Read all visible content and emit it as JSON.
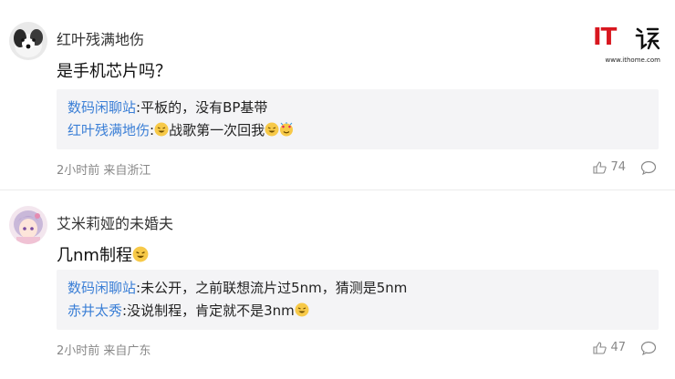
{
  "logo": {
    "text": "IT",
    "url": "www.ithome.com",
    "brand_color": "#d8171f"
  },
  "comments": [
    {
      "username": "红叶残满地伤",
      "content": "是手机芯片吗？",
      "replies": [
        {
          "user": "数码闲聊站",
          "sep": ":",
          "text": "平板的，没有BP基带"
        },
        {
          "user": "红叶残满地伤",
          "sep": ":",
          "text": "战歌第一次回我"
        }
      ],
      "time": "2小时前",
      "location": "来自浙江",
      "likes": "74"
    },
    {
      "username": "艾米莉娅的未婚夫",
      "content": "几nm制程",
      "replies": [
        {
          "user": "数码闲聊站",
          "sep": ":",
          "text": "未公开，之前联想流片过5nm，猜测是5nm"
        },
        {
          "user": "赤井太秀",
          "sep": ":",
          "text": "没说制程，肯定就不是3nm"
        }
      ],
      "time": "2小时前",
      "location": "来自广东",
      "likes": "47"
    }
  ],
  "colors": {
    "link": "#3b7fd6",
    "reply_bg": "#f4f4f6",
    "meta": "#888888"
  }
}
